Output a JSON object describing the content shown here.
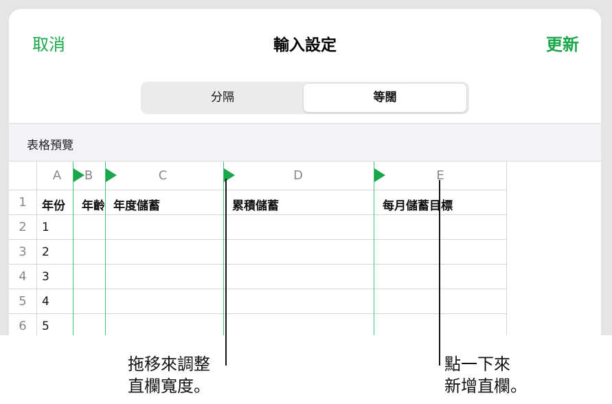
{
  "nav": {
    "cancel": "取消",
    "title": "輸入設定",
    "update": "更新"
  },
  "segments": {
    "separated": "分隔",
    "fixed_width": "等闊"
  },
  "preview": {
    "label": "表格預覽"
  },
  "table": {
    "columns": [
      "A",
      "B",
      "C",
      "D",
      "E"
    ],
    "rows": [
      "1",
      "2",
      "3",
      "4",
      "5",
      "6"
    ],
    "headers": [
      "年份",
      "年齡",
      "年度儲蓄",
      "累積儲蓄",
      "每月儲蓄目標"
    ],
    "col_a_values": [
      "1",
      "2",
      "3",
      "4",
      "5"
    ]
  },
  "callouts": {
    "drag_line1": "拖移來調整",
    "drag_line2": "直欄寬度。",
    "tap_line1": "點一下來",
    "tap_line2": "新增直欄。"
  },
  "colors": {
    "accent": "#1aa64a",
    "guide": "#46c277"
  }
}
